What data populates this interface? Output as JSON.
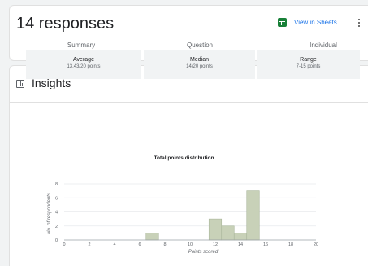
{
  "header": {
    "title": "14 responses",
    "sheets_label": "View in Sheets",
    "sheets_color": "#188038",
    "link_color": "#1a73e8"
  },
  "tabs": [
    {
      "label": "Summary",
      "active": true
    },
    {
      "label": "Question",
      "active": false
    },
    {
      "label": "Individual",
      "active": false
    }
  ],
  "insights": {
    "title": "Insights",
    "stats": [
      {
        "label": "Average",
        "value": "13.43/20 points"
      },
      {
        "label": "Median",
        "value": "14/20 points"
      },
      {
        "label": "Range",
        "value": "7-15 points"
      }
    ]
  },
  "chart_data": {
    "type": "bar",
    "title": "Total points distribution",
    "xlabel": "Points scored",
    "ylabel": "No. of respondents",
    "x_ticks": [
      0,
      2,
      4,
      6,
      8,
      10,
      12,
      14,
      16,
      18,
      20
    ],
    "y_ticks": [
      0,
      2,
      4,
      6,
      8
    ],
    "xlim": [
      0,
      20
    ],
    "ylim": [
      0,
      8
    ],
    "grid": true,
    "bar_color": "#c8d1b8",
    "bar_stroke": "#a9b59a",
    "x": [
      7,
      12,
      13,
      14,
      15
    ],
    "values": [
      1,
      3,
      2,
      1,
      7
    ]
  }
}
